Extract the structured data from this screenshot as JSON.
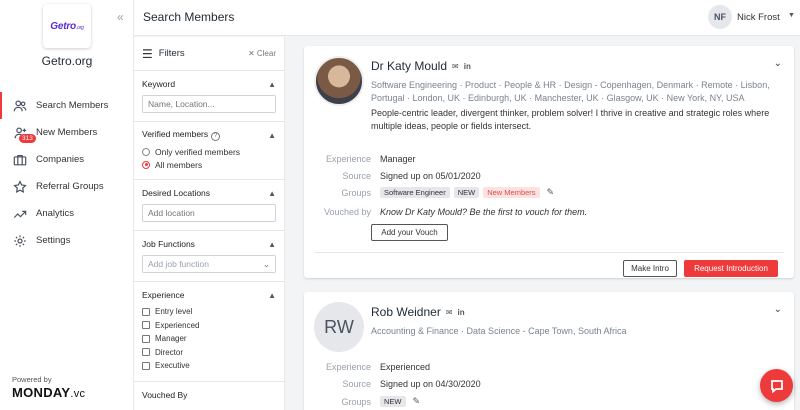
{
  "sidebar": {
    "logo": "Getro",
    "logo_suffix": ".org",
    "org_name": "Getro.org",
    "collapse_icon": "double-chevron-left-icon",
    "items": [
      {
        "label": "Search Members",
        "icon": "users-icon",
        "active": true
      },
      {
        "label": "New Members",
        "icon": "user-plus-icon",
        "badge": "313"
      },
      {
        "label": "Companies",
        "icon": "briefcase-icon"
      },
      {
        "label": "Referral Groups",
        "icon": "star-icon"
      },
      {
        "label": "Analytics",
        "icon": "trend-icon"
      },
      {
        "label": "Settings",
        "icon": "gear-icon"
      }
    ],
    "powered_by": "Powered by",
    "brand": "MONDAY",
    "brand_suffix": ".vc"
  },
  "header": {
    "title": "Search Members",
    "user_initials": "NF",
    "user_name": "Nick Frost"
  },
  "filters": {
    "title": "Filters",
    "clear": "Clear",
    "keyword": {
      "title": "Keyword",
      "placeholder": "Name, Location..."
    },
    "verified": {
      "title": "Verified members",
      "options": [
        "Only verified members",
        "All members"
      ],
      "selected": "All members"
    },
    "locations": {
      "title": "Desired Locations",
      "placeholder": "Add location"
    },
    "job_functions": {
      "title": "Job Functions",
      "placeholder": "Add job function"
    },
    "experience": {
      "title": "Experience",
      "options": [
        "Entry level",
        "Experienced",
        "Manager",
        "Director",
        "Executive"
      ]
    },
    "vouched_by": {
      "title": "Vouched By"
    }
  },
  "members": [
    {
      "name": "Dr Katy Mould",
      "tags": "Software Engineering · Product · People & HR · Design - Copenhagen, Denmark · Remote · Lisbon, Portugal · London, UK · Edinburgh, UK · Manchester, UK · Glasgow, UK · New York, NY, USA",
      "bio": "People-centric leader, divergent thinker, problem solver! I thrive in creative and strategic roles where multiple ideas, people or fields intersect.",
      "experience_label": "Experience",
      "experience": "Manager",
      "source_label": "Source",
      "source": "Signed up on 05/01/2020",
      "groups_label": "Groups",
      "groups": [
        {
          "name": "Software Engineer",
          "style": "grey"
        },
        {
          "name": "NEW",
          "style": "grey"
        },
        {
          "name": "New Members",
          "style": "pink"
        }
      ],
      "vouched_label": "Vouched by",
      "vouched_text": "Know Dr Katy Mould? Be the first to vouch for them.",
      "vouch_button": "Add your Vouch",
      "intro_button": "Make Intro",
      "request_button": "Request Introduction"
    },
    {
      "name": "Rob Weidner",
      "initials": "RW",
      "tags": "Accounting & Finance · Data Science - Cape Town, South Africa",
      "experience_label": "Experience",
      "experience": "Experienced",
      "source_label": "Source",
      "source": "Signed up on 04/30/2020",
      "groups_label": "Groups",
      "groups": [
        {
          "name": "NEW",
          "style": "grey"
        }
      ]
    }
  ],
  "colors": {
    "accent": "#ee3a3a",
    "brand": "#5b2bd7"
  }
}
